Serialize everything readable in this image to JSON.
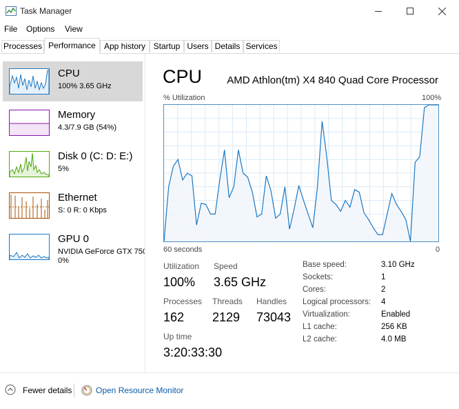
{
  "window": {
    "title": "Task Manager"
  },
  "menu": [
    "File",
    "Options",
    "View"
  ],
  "tabs": [
    "Processes",
    "Performance",
    "App history",
    "Startup",
    "Users",
    "Details",
    "Services"
  ],
  "sidebar": {
    "items": [
      {
        "title": "CPU",
        "sub": "100% 3.65 GHz",
        "color": "#1a78c2"
      },
      {
        "title": "Memory",
        "sub": "4.3/7.9 GB (54%)",
        "color": "#8b12ae"
      },
      {
        "title": "Disk 0 (C: D: E:)",
        "sub": "5%",
        "color": "#4da60c"
      },
      {
        "title": "Ethernet",
        "sub": "S: 0 R: 0 Kbps",
        "color": "#a74f01"
      },
      {
        "title": "GPU 0",
        "sub1": "NVIDIA GeForce GTX 750",
        "sub2": "0%",
        "color": "#1a78c2"
      }
    ]
  },
  "cpu": {
    "title": "CPU",
    "model": "AMD Athlon(tm) X4 840 Quad Core Processor",
    "util_label": "% Utilization",
    "max_label": "100%",
    "time_label": "60 seconds",
    "zero_label": "0",
    "utilization_label": "Utilization",
    "utilization": "100%",
    "speed_label": "Speed",
    "speed": "3.65 GHz",
    "processes_label": "Processes",
    "processes": "162",
    "threads_label": "Threads",
    "threads": "2129",
    "handles_label": "Handles",
    "handles": "73043",
    "uptime_label": "Up time",
    "uptime": "3:20:33:30",
    "details": [
      {
        "label": "Base speed:",
        "value": "3.10 GHz"
      },
      {
        "label": "Sockets:",
        "value": "1"
      },
      {
        "label": "Cores:",
        "value": "2"
      },
      {
        "label": "Logical processors:",
        "value": "4"
      },
      {
        "label": "Virtualization:",
        "value": "Enabled"
      },
      {
        "label": "L1 cache:",
        "value": "256 KB"
      },
      {
        "label": "L2 cache:",
        "value": "4.0 MB"
      }
    ],
    "history": [
      0,
      40,
      55,
      60,
      45,
      50,
      48,
      12,
      28,
      27,
      20,
      20,
      45,
      67,
      32,
      40,
      67,
      50,
      47,
      36,
      18,
      20,
      48,
      37,
      17,
      20,
      40,
      9,
      24,
      41,
      30,
      20,
      10,
      40,
      88,
      62,
      30,
      27,
      22,
      30,
      25,
      38,
      36,
      21,
      16,
      10,
      5,
      5,
      20,
      35,
      27,
      22,
      16,
      0,
      58,
      62,
      98,
      100,
      100,
      100
    ]
  },
  "footer": {
    "fewer": "Fewer details",
    "monitor": "Open Resource Monitor"
  }
}
